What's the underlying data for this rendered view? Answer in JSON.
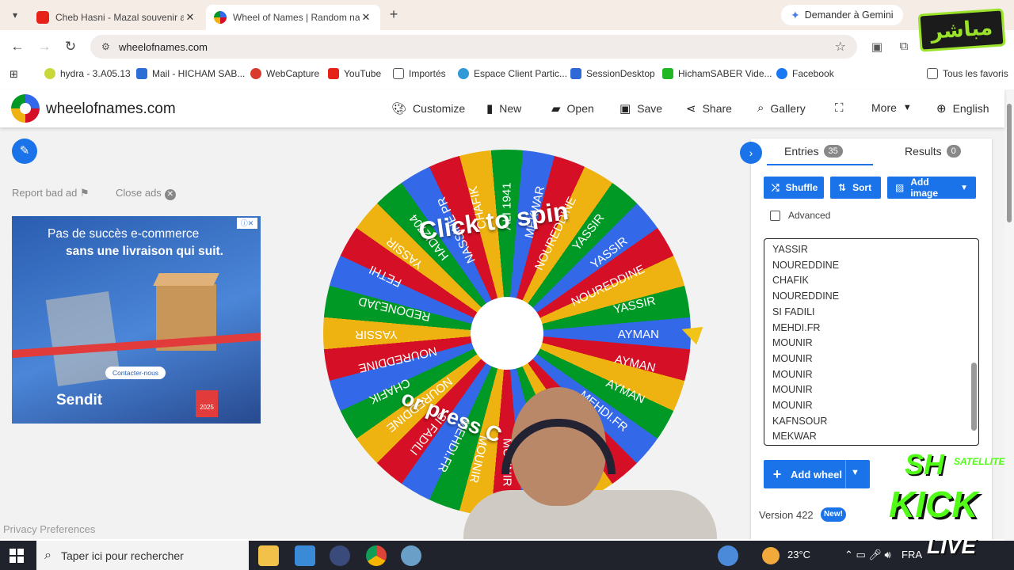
{
  "browser": {
    "tabs": [
      {
        "title": "Cheb Hasni - Mazal souvenir am"
      },
      {
        "title": "Wheel of Names | Random nam"
      }
    ],
    "gemini_label": "Demander à Gemini",
    "url": "wheelofnames.com",
    "bookmarks": [
      "hydra - 3.A05.13",
      "Mail - HICHAM SAB...",
      "WebCapture",
      "YouTube",
      "Importés",
      "Espace Client Partic...",
      "SessionDesktop",
      "HichamSABER Vide...",
      "Facebook",
      "Tous les favoris"
    ]
  },
  "site": {
    "brand": "wheelofnames.com",
    "nav": [
      "Customize",
      "New",
      "Open",
      "Save",
      "Share",
      "Gallery",
      "More",
      "English"
    ],
    "report_bad_ad": "Report bad ad",
    "close_ads": "Close ads",
    "privacy": "Privacy Preferences",
    "ad": {
      "line1": "Pas de succès e-commerce",
      "line2": "sans une livraison qui suit.",
      "cta": "Contacter-nous",
      "brand": "Sendit",
      "year": "2025"
    },
    "wheel": {
      "click_to_spin": "Click to spin",
      "or_press": "or press C",
      "labels": [
        "AYMAN",
        "AYMAN",
        "AYMAN",
        "MEHDI.FR",
        "YASSIR",
        "MOUNIR",
        "MOUNIR",
        "MOUNIR",
        "MOUNIR",
        "MEHDI.FR",
        "SI FADILI",
        "NOUREDDINE",
        "CHAFIK",
        "NOUREDDINE",
        "YASSIR",
        "REDONEJAD",
        "FETHI",
        "YASSIR",
        "HADI2704",
        "NASSINE PR",
        "CHAFIK",
        "ALI 1941",
        "MEKWAR",
        "NOUREDDINE",
        "YASSIR",
        "YASSIR",
        "NOUREDDINE",
        "YASSIR"
      ]
    }
  },
  "panel": {
    "entries_tab": "Entries",
    "entries_count": "35",
    "results_tab": "Results",
    "results_count": "0",
    "shuffle": "Shuffle",
    "sort": "Sort",
    "add_image": "Add image",
    "advanced": "Advanced",
    "entries": [
      "YASSIR",
      "NOUREDDINE",
      "CHAFIK",
      "NOUREDDINE",
      "SI FADILI",
      "MEHDI.FR",
      "MOUNIR",
      "MOUNIR",
      "MOUNIR",
      "MOUNIR",
      "MOUNIR",
      "KAFNSOUR",
      "MEKWAR"
    ],
    "add_wheel": "Add wheel",
    "version": "Version 422",
    "new_badge": "New!"
  },
  "taskbar": {
    "search_placeholder": "Taper ici pour rechercher",
    "weather": "23°C",
    "lang": "FRA"
  },
  "overlay": {
    "mubashir": "مباشر",
    "sh": "SH",
    "satellite": "SATELLITE",
    "kick": "KICK",
    "live": "LIVE"
  },
  "colors": {
    "accent": "#1a73e8",
    "wheel_green": "#009925",
    "wheel_blue": "#3369e8",
    "wheel_red": "#d50f25",
    "wheel_yellow": "#eeb211",
    "kick_green": "#53fc18"
  }
}
